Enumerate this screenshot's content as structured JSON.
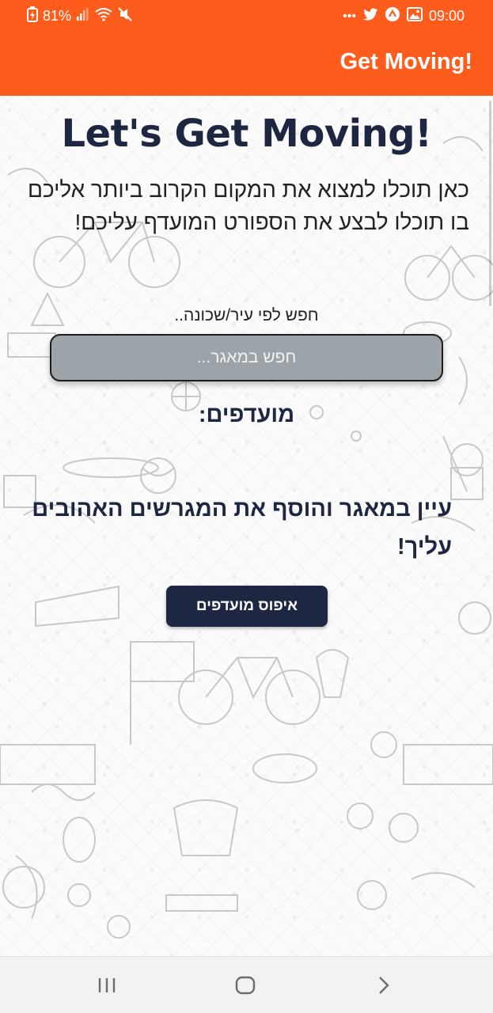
{
  "status_bar": {
    "battery_level": "81%",
    "time": "09:00",
    "icons": [
      "battery-charging-icon",
      "signal-icon",
      "wifi-icon",
      "mute-icon",
      "more-icon",
      "twitter-icon",
      "notification-icon",
      "gallery-icon"
    ]
  },
  "app_bar": {
    "title": "Get Moving!"
  },
  "main": {
    "heading": "Let's Get Moving!",
    "intro_text": "כאן תוכלו למצוא את המקום הקרוב ביותר אליכם בו תוכלו לבצע את הספורט המועדף עליכם!",
    "search": {
      "label": "חפש לפי עיר/שכונה..",
      "placeholder": "חפש במאגר..."
    },
    "favorites": {
      "title": "מועדפים:",
      "empty_message": "עיין במאגר והוסף את המגרשים האהובים עליך!",
      "reset_button_label": "איפוס מועדפים"
    }
  },
  "nav_bar": {
    "recent_apps_icon": "recent-apps-icon",
    "home_icon": "home-icon",
    "back_icon": "back-icon"
  },
  "colors": {
    "accent": "#fe5c1c",
    "dark_navy": "#1e2741",
    "search_bg": "#9ca3a9"
  }
}
